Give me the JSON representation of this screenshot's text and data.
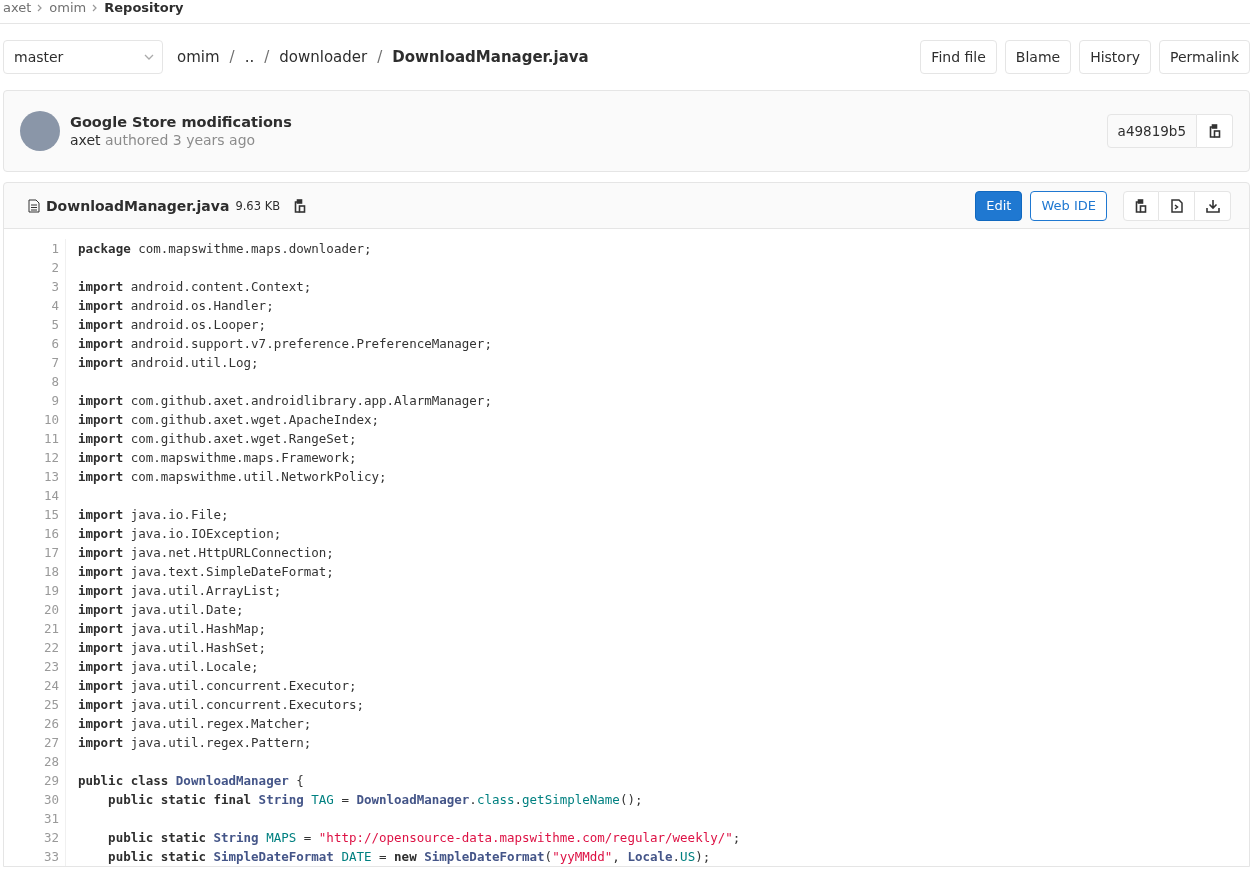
{
  "breadcrumbs": [
    {
      "label": "axet",
      "current": false
    },
    {
      "label": "omim",
      "current": false
    },
    {
      "label": "Repository",
      "current": true
    }
  ],
  "branch_select": {
    "value": "master"
  },
  "path": [
    {
      "label": "omim",
      "current": false
    },
    {
      "label": "..",
      "current": false
    },
    {
      "label": "downloader",
      "current": false
    },
    {
      "label": "DownloadManager.java",
      "current": true
    }
  ],
  "path_separator": "/",
  "actions": [
    "Find file",
    "Blame",
    "History",
    "Permalink"
  ],
  "commit": {
    "title": "Google Store modifications",
    "author": "axet",
    "meta": "authored 3 years ago",
    "sha": "a49819b5"
  },
  "file": {
    "name": "DownloadManager.java",
    "size": "9.63 KB",
    "edit": "Edit",
    "web_ide": "Web IDE"
  },
  "code_lines": [
    {
      "number": "1",
      "tokens": [
        {
          "kind": "k",
          "text": "package"
        },
        {
          "kind": "p",
          "text": " com.mapswithme.maps.downloader;"
        }
      ]
    },
    {
      "number": "2"
    },
    {
      "number": "3",
      "tokens": [
        {
          "kind": "k",
          "text": "import"
        },
        {
          "kind": "p",
          "text": " android.content.Context;"
        }
      ]
    },
    {
      "number": "4",
      "tokens": [
        {
          "kind": "k",
          "text": "import"
        },
        {
          "kind": "p",
          "text": " android.os.Handler;"
        }
      ]
    },
    {
      "number": "5",
      "tokens": [
        {
          "kind": "k",
          "text": "import"
        },
        {
          "kind": "p",
          "text": " android.os.Looper;"
        }
      ]
    },
    {
      "number": "6",
      "tokens": [
        {
          "kind": "k",
          "text": "import"
        },
        {
          "kind": "p",
          "text": " android.support.v7.preference.PreferenceManager;"
        }
      ]
    },
    {
      "number": "7",
      "tokens": [
        {
          "kind": "k",
          "text": "import"
        },
        {
          "kind": "p",
          "text": " android.util.Log;"
        }
      ]
    },
    {
      "number": "8"
    },
    {
      "number": "9",
      "tokens": [
        {
          "kind": "k",
          "text": "import"
        },
        {
          "kind": "p",
          "text": " com.github.axet.androidlibrary.app.AlarmManager;"
        }
      ]
    },
    {
      "number": "10",
      "tokens": [
        {
          "kind": "k",
          "text": "import"
        },
        {
          "kind": "p",
          "text": " com.github.axet.wget.ApacheIndex;"
        }
      ]
    },
    {
      "number": "11",
      "tokens": [
        {
          "kind": "k",
          "text": "import"
        },
        {
          "kind": "p",
          "text": " com.github.axet.wget.RangeSet;"
        }
      ]
    },
    {
      "number": "12",
      "tokens": [
        {
          "kind": "k",
          "text": "import"
        },
        {
          "kind": "p",
          "text": " com.mapswithme.maps.Framework;"
        }
      ]
    },
    {
      "number": "13",
      "tokens": [
        {
          "kind": "k",
          "text": "import"
        },
        {
          "kind": "p",
          "text": " com.mapswithme.util.NetworkPolicy;"
        }
      ]
    },
    {
      "number": "14"
    },
    {
      "number": "15",
      "tokens": [
        {
          "kind": "k",
          "text": "import"
        },
        {
          "kind": "p",
          "text": " java.io.File;"
        }
      ]
    },
    {
      "number": "16",
      "tokens": [
        {
          "kind": "k",
          "text": "import"
        },
        {
          "kind": "p",
          "text": " java.io.IOException;"
        }
      ]
    },
    {
      "number": "17",
      "tokens": [
        {
          "kind": "k",
          "text": "import"
        },
        {
          "kind": "p",
          "text": " java.net.HttpURLConnection;"
        }
      ]
    },
    {
      "number": "18",
      "tokens": [
        {
          "kind": "k",
          "text": "import"
        },
        {
          "kind": "p",
          "text": " java.text.SimpleDateFormat;"
        }
      ]
    },
    {
      "number": "19",
      "tokens": [
        {
          "kind": "k",
          "text": "import"
        },
        {
          "kind": "p",
          "text": " java.util.ArrayList;"
        }
      ]
    },
    {
      "number": "20",
      "tokens": [
        {
          "kind": "k",
          "text": "import"
        },
        {
          "kind": "p",
          "text": " java.util.Date;"
        }
      ]
    },
    {
      "number": "21",
      "tokens": [
        {
          "kind": "k",
          "text": "import"
        },
        {
          "kind": "p",
          "text": " java.util.HashMap;"
        }
      ]
    },
    {
      "number": "22",
      "tokens": [
        {
          "kind": "k",
          "text": "import"
        },
        {
          "kind": "p",
          "text": " java.util.HashSet;"
        }
      ]
    },
    {
      "number": "23",
      "tokens": [
        {
          "kind": "k",
          "text": "import"
        },
        {
          "kind": "p",
          "text": " java.util.Locale;"
        }
      ]
    },
    {
      "number": "24",
      "tokens": [
        {
          "kind": "k",
          "text": "import"
        },
        {
          "kind": "p",
          "text": " java.util.concurrent.Executor;"
        }
      ]
    },
    {
      "number": "25",
      "tokens": [
        {
          "kind": "k",
          "text": "import"
        },
        {
          "kind": "p",
          "text": " java.util.concurrent.Executors;"
        }
      ]
    },
    {
      "number": "26",
      "tokens": [
        {
          "kind": "k",
          "text": "import"
        },
        {
          "kind": "p",
          "text": " java.util.regex.Matcher;"
        }
      ]
    },
    {
      "number": "27",
      "tokens": [
        {
          "kind": "k",
          "text": "import"
        },
        {
          "kind": "p",
          "text": " java.util.regex.Pattern;"
        }
      ]
    },
    {
      "number": "28"
    },
    {
      "number": "29",
      "tokens": [
        {
          "kind": "k",
          "text": "public class"
        },
        {
          "kind": "t",
          "text": " DownloadManager"
        },
        {
          "kind": "p",
          "text": " {"
        }
      ]
    },
    {
      "number": "30",
      "tokens": [
        {
          "kind": "k",
          "text": "    public static final"
        },
        {
          "kind": "t",
          "text": " String"
        },
        {
          "kind": "v",
          "text": " TAG"
        },
        {
          "kind": "p",
          "text": " = "
        },
        {
          "kind": "t",
          "text": "DownloadManager"
        },
        {
          "kind": "p",
          "text": "."
        },
        {
          "kind": "v",
          "text": "class"
        },
        {
          "kind": "p",
          "text": "."
        },
        {
          "kind": "v",
          "text": "getSimpleName"
        },
        {
          "kind": "p",
          "text": "();"
        }
      ]
    },
    {
      "number": "31"
    },
    {
      "number": "32",
      "tokens": [
        {
          "kind": "k",
          "text": "    public static"
        },
        {
          "kind": "t",
          "text": " String"
        },
        {
          "kind": "v",
          "text": " MAPS"
        },
        {
          "kind": "p",
          "text": " = "
        },
        {
          "kind": "s",
          "text": "\"http://opensource-data.mapswithme.com/regular/weekly/\""
        },
        {
          "kind": "p",
          "text": ";"
        }
      ]
    },
    {
      "number": "33",
      "tokens": [
        {
          "kind": "k",
          "text": "    public static"
        },
        {
          "kind": "t",
          "text": " SimpleDateFormat"
        },
        {
          "kind": "v",
          "text": " DATE"
        },
        {
          "kind": "p",
          "text": " = "
        },
        {
          "kind": "k",
          "text": "new"
        },
        {
          "kind": "t",
          "text": " SimpleDateFormat"
        },
        {
          "kind": "p",
          "text": "("
        },
        {
          "kind": "s",
          "text": "\"yyMMdd\""
        },
        {
          "kind": "p",
          "text": ", "
        },
        {
          "kind": "t",
          "text": "Locale"
        },
        {
          "kind": "p",
          "text": "."
        },
        {
          "kind": "v",
          "text": "US"
        },
        {
          "kind": "p",
          "text": ");"
        }
      ]
    }
  ]
}
